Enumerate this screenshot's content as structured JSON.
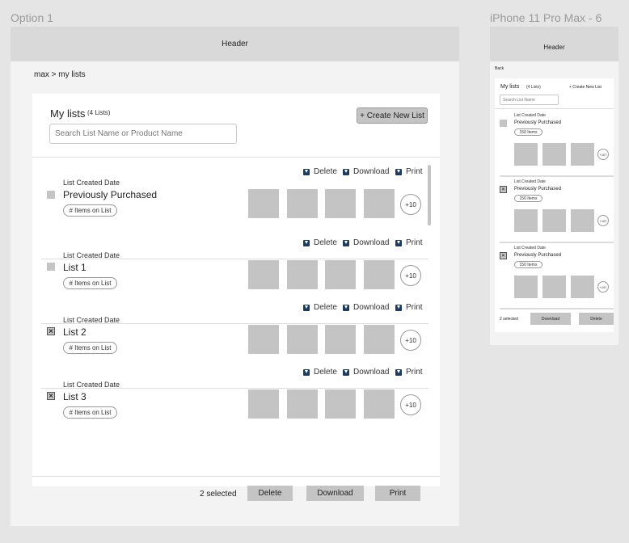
{
  "desktop": {
    "frame_label": "Option 1",
    "header": "Header",
    "breadcrumb": "max > my lists",
    "card": {
      "title": "My lists",
      "count": "(4 Lists)",
      "create_button": "+ Create New List",
      "search_placeholder": "Search List Name or Product Name"
    },
    "actions": {
      "delete": "Delete",
      "download": "Download",
      "print": "Print"
    },
    "lists": [
      {
        "date": "List Created Date",
        "name": "Previously Purchased",
        "items": "# Items on List",
        "more": "+10",
        "checked": false
      },
      {
        "date": "List Created Date",
        "name": "List 1",
        "items": "# Items on List",
        "more": "+10",
        "checked": false
      },
      {
        "date": "List Created Date",
        "name": "List 2",
        "items": "# Items on List",
        "more": "+10",
        "checked": true
      },
      {
        "date": "List Created Date",
        "name": "List 3",
        "items": "# Items on List",
        "more": "+10",
        "checked": true
      }
    ],
    "footer": {
      "selected": "2 selected",
      "delete": "Delete",
      "download": "Download",
      "print": "Print"
    }
  },
  "mobile": {
    "frame_label": "iPhone 11 Pro Max - 6",
    "header": "Header",
    "back": "Back",
    "title": "My lists",
    "count": "(4 Lists)",
    "create": "+ Create New List",
    "search_placeholder": "Search List Name",
    "lists": [
      {
        "date": "List Created Date",
        "name": "Previously Purchased",
        "items": "150 Items",
        "more": "+107",
        "checked": false
      },
      {
        "date": "List Created Date",
        "name": "Previously Purchased",
        "items": "150 Items",
        "more": "+107",
        "checked": true
      },
      {
        "date": "List Created Date",
        "name": "Previously Purchased",
        "items": "150 Items",
        "more": "+107",
        "checked": true
      }
    ],
    "footer": {
      "selected": "2 selected",
      "download": "Download",
      "delete": "Delete"
    }
  },
  "check_mark": "×"
}
